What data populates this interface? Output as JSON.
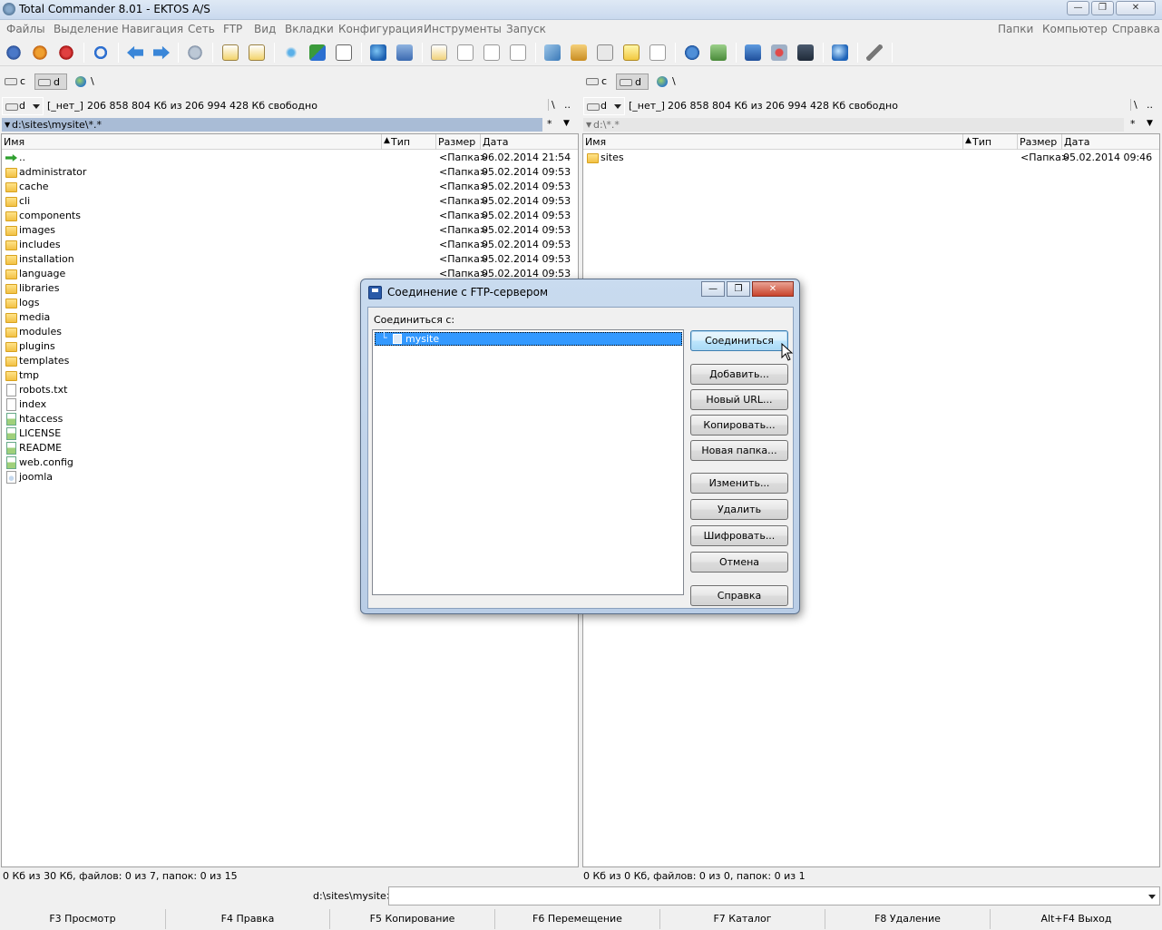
{
  "window": {
    "title": "Total Commander 8.01 - EKTOS A/S",
    "min": "—",
    "max": "❐",
    "close": "✕"
  },
  "menu": {
    "left": [
      "Файлы",
      "Выделение",
      "Навигация",
      "Сеть",
      "FTP",
      "Вид",
      "Вкладки",
      "Конфигурация",
      "Инструменты",
      "Запуск"
    ],
    "right": [
      "Папки",
      "Компьютер",
      "Справка"
    ]
  },
  "drives": {
    "c": "c",
    "d": "d",
    "net": "\\"
  },
  "left_panel": {
    "drive": "d",
    "drive_label": "[_нет_]",
    "free_text": "206 858 804 Кб из 206 994 428 Кб свободно",
    "root_btn": "\\",
    "up_btn": "..",
    "path": "d:\\sites\\mysite\\*.*",
    "filter": "*",
    "headers": {
      "name": "Имя",
      "type": "Тип",
      "size": "Размер",
      "date": "Дата"
    },
    "rows": [
      {
        "name": "..",
        "kind": "up",
        "size": "<Папка>",
        "date": "06.02.2014 21:54"
      },
      {
        "name": "administrator",
        "kind": "folder",
        "size": "<Папка>",
        "date": "05.02.2014 09:53"
      },
      {
        "name": "cache",
        "kind": "folder",
        "size": "<Папка>",
        "date": "05.02.2014 09:53"
      },
      {
        "name": "cli",
        "kind": "folder",
        "size": "<Папка>",
        "date": "05.02.2014 09:53"
      },
      {
        "name": "components",
        "kind": "folder",
        "size": "<Папка>",
        "date": "05.02.2014 09:53"
      },
      {
        "name": "images",
        "kind": "folder",
        "size": "<Папка>",
        "date": "05.02.2014 09:53"
      },
      {
        "name": "includes",
        "kind": "folder",
        "size": "<Папка>",
        "date": "05.02.2014 09:53"
      },
      {
        "name": "installation",
        "kind": "folder",
        "size": "<Папка>",
        "date": "05.02.2014 09:53"
      },
      {
        "name": "language",
        "kind": "folder",
        "size": "<Папка>",
        "date": "05.02.2014 09:53"
      },
      {
        "name": "libraries",
        "kind": "folder",
        "size": "",
        "date": ""
      },
      {
        "name": "logs",
        "kind": "folder",
        "size": "",
        "date": ""
      },
      {
        "name": "media",
        "kind": "folder",
        "size": "",
        "date": ""
      },
      {
        "name": "modules",
        "kind": "folder",
        "size": "",
        "date": ""
      },
      {
        "name": "plugins",
        "kind": "folder",
        "size": "",
        "date": ""
      },
      {
        "name": "templates",
        "kind": "folder",
        "size": "",
        "date": ""
      },
      {
        "name": "tmp",
        "kind": "folder",
        "size": "",
        "date": ""
      },
      {
        "name": "robots.txt",
        "kind": "file",
        "size": "",
        "date": ""
      },
      {
        "name": "index",
        "kind": "file",
        "size": "",
        "date": ""
      },
      {
        "name": "htaccess",
        "kind": "green",
        "size": "",
        "date": ""
      },
      {
        "name": "LICENSE",
        "kind": "green",
        "size": "",
        "date": ""
      },
      {
        "name": "README",
        "kind": "green",
        "size": "",
        "date": ""
      },
      {
        "name": "web.config",
        "kind": "green",
        "size": "",
        "date": ""
      },
      {
        "name": "joomla",
        "kind": "joomla",
        "size": "",
        "date": ""
      }
    ],
    "status": "0 Кб из 30 Кб, файлов: 0 из 7, папок: 0 из 15"
  },
  "right_panel": {
    "drive": "d",
    "drive_label": "[_нет_]",
    "free_text": "206 858 804 Кб из 206 994 428 Кб свободно",
    "root_btn": "\\",
    "up_btn": "..",
    "path": "d:\\*.*",
    "filter": "*",
    "headers": {
      "name": "Имя",
      "type": "Тип",
      "size": "Размер",
      "date": "Дата"
    },
    "rows": [
      {
        "name": "sites",
        "kind": "folder",
        "size": "<Папка>",
        "date": "05.02.2014 09:46"
      }
    ],
    "status": "0 Кб из 0 Кб, файлов: 0 из 0, папок: 0 из 1"
  },
  "cmdline": {
    "label": "d:\\sites\\mysite>",
    "value": ""
  },
  "fkeys": [
    "F3 Просмотр",
    "F4 Правка",
    "F5 Копирование",
    "F6 Перемещение",
    "F7 Каталог",
    "F8 Удаление",
    "Alt+F4 Выход"
  ],
  "dialog": {
    "title": "Соединение с FTP-сервером",
    "connect_to_label": "Соединиться с:",
    "tree": [
      {
        "label": "mysite",
        "selected": true
      }
    ],
    "buttons": [
      "Соединиться",
      "Добавить...",
      "Новый URL...",
      "Копировать...",
      "Новая папка...",
      "Изменить...",
      "Удалить",
      "Шифровать...",
      "Отмена",
      "Справка"
    ]
  }
}
